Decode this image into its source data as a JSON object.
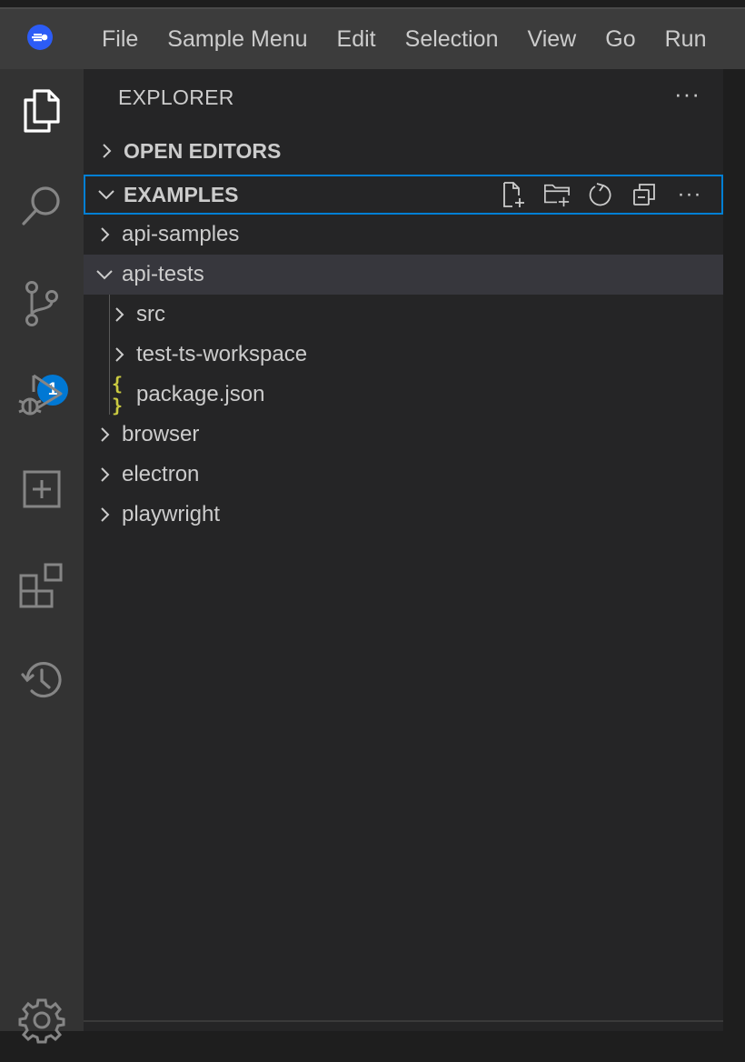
{
  "menu": {
    "items": [
      "File",
      "Sample Menu",
      "Edit",
      "Selection",
      "View",
      "Go",
      "Run"
    ]
  },
  "activity_bar": {
    "items": [
      "explorer-icon",
      "search-icon",
      "source-control-icon",
      "run-debug-icon",
      "plugin-icon",
      "extensions-icon",
      "timeline-icon",
      "settings-gear-icon"
    ],
    "scm_badge": "1"
  },
  "explorer": {
    "title": "EXPLORER",
    "more": "···",
    "open_editors": {
      "label": "OPEN EDITORS"
    },
    "workspace": {
      "label": "EXAMPLES",
      "actions": [
        "new-file-icon",
        "new-folder-icon",
        "refresh-icon",
        "collapse-all-icon",
        "more-icon"
      ],
      "more": "···"
    },
    "tree": [
      {
        "name": "api-samples",
        "type": "folder",
        "expanded": false,
        "depth": 0
      },
      {
        "name": "api-tests",
        "type": "folder",
        "expanded": true,
        "depth": 0,
        "selected": true
      },
      {
        "name": "src",
        "type": "folder",
        "expanded": false,
        "depth": 1
      },
      {
        "name": "test-ts-workspace",
        "type": "folder",
        "expanded": false,
        "depth": 1
      },
      {
        "name": "package.json",
        "type": "json",
        "depth": 1,
        "icon_text": "{ }"
      },
      {
        "name": "browser",
        "type": "folder",
        "expanded": false,
        "depth": 0
      },
      {
        "name": "electron",
        "type": "folder",
        "expanded": false,
        "depth": 0
      },
      {
        "name": "playwright",
        "type": "folder",
        "expanded": false,
        "depth": 0
      }
    ]
  },
  "colors": {
    "titlebar": "#3c3c3c",
    "activitybar": "#333333",
    "sidebar": "#252526",
    "focus_border": "#007fd4",
    "badge": "#0078d4",
    "json_icon": "#cbcb41"
  }
}
